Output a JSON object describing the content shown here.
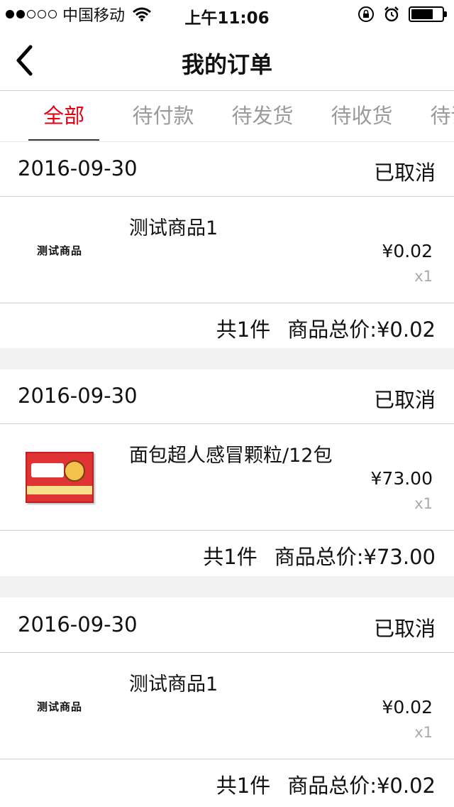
{
  "status_bar": {
    "carrier": "中国移动",
    "time": "上午11:06"
  },
  "nav": {
    "title": "我的订单"
  },
  "tabs": [
    {
      "label": "全部",
      "active": true
    },
    {
      "label": "待付款",
      "active": false
    },
    {
      "label": "待发货",
      "active": false
    },
    {
      "label": "待收货",
      "active": false
    },
    {
      "label": "待评价",
      "active": false
    }
  ],
  "orders": [
    {
      "date": "2016-09-30",
      "status": "已取消",
      "thumb_text": "测试商品",
      "name": "测试商品1",
      "price": "¥0.02",
      "qty": "x1",
      "count": "共1件",
      "total": "商品总价:¥0.02"
    },
    {
      "date": "2016-09-30",
      "status": "已取消",
      "thumb_text": "",
      "name": "面包超人感冒颗粒/12包",
      "price": "¥73.00",
      "qty": "x1",
      "count": "共1件",
      "total": "商品总价:¥73.00"
    },
    {
      "date": "2016-09-30",
      "status": "已取消",
      "thumb_text": "测试商品",
      "name": "测试商品1",
      "price": "¥0.02",
      "qty": "x1",
      "count": "共1件",
      "total": "商品总价:¥0.02"
    }
  ],
  "colors": {
    "accent": "#e60012",
    "inactive_tab": "#9a9a9a",
    "separator": "#f2f2f2"
  }
}
